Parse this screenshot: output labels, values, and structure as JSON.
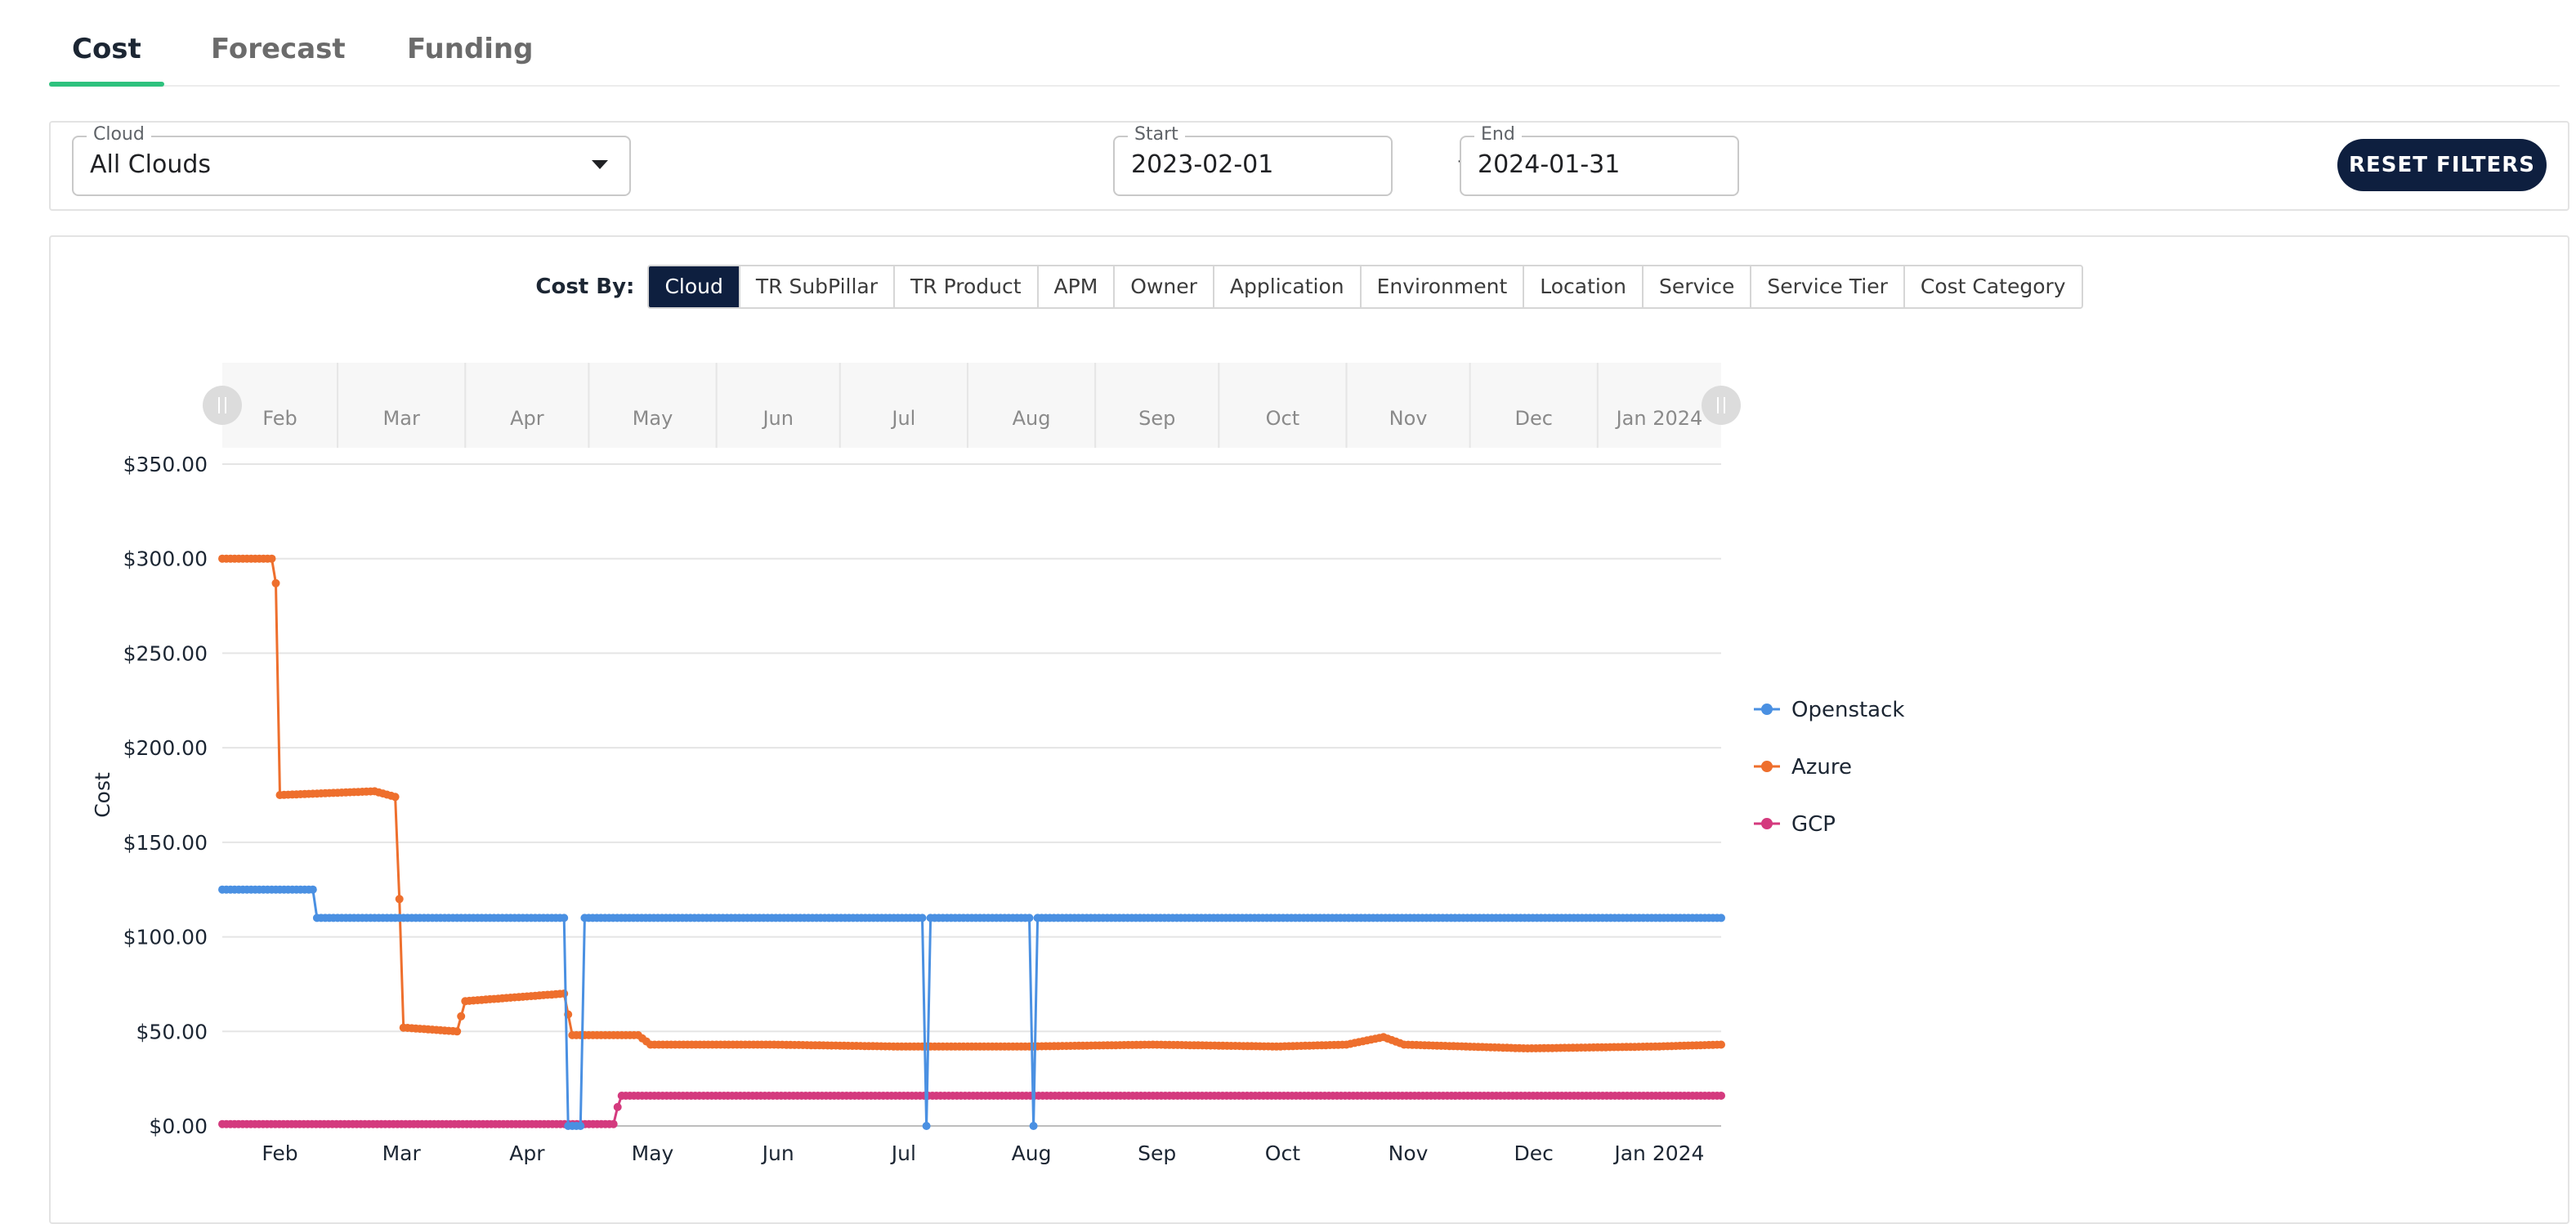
{
  "tabs": [
    {
      "label": "Cost",
      "active": true
    },
    {
      "label": "Forecast",
      "active": false
    },
    {
      "label": "Funding",
      "active": false
    }
  ],
  "filters": {
    "cloud_label": "Cloud",
    "cloud_value": "All Clouds",
    "start_label": "Start",
    "start_value": "2023-02-01",
    "to_label": "to",
    "end_label": "End",
    "end_value": "2024-01-31",
    "reset_label": "RESET FILTERS"
  },
  "cost_by": {
    "label": "Cost By:",
    "options": [
      "Cloud",
      "TR SubPillar",
      "TR Product",
      "APM",
      "Owner",
      "Application",
      "Environment",
      "Location",
      "Service",
      "Service Tier",
      "Cost Category"
    ],
    "selected": "Cloud"
  },
  "colors": {
    "accent": "#2ec27e",
    "button": "#0e1f3f",
    "Openstack": "#4a90e2",
    "Azure": "#ee6f2d",
    "GCP": "#d43a7e"
  },
  "chart_data": {
    "type": "line",
    "ylabel": "Cost",
    "xlabel": "",
    "x_range": [
      "2023-02-01",
      "2024-01-31"
    ],
    "x_ticks": [
      "Feb",
      "Mar",
      "Apr",
      "May",
      "Jun",
      "Jul",
      "Aug",
      "Sep",
      "Oct",
      "Nov",
      "Dec",
      "Jan 2024"
    ],
    "y_ticks": [
      "$0.00",
      "$50.00",
      "$100.00",
      "$150.00",
      "$200.00",
      "$250.00",
      "$300.00",
      "$350.00"
    ],
    "ylim": [
      0,
      350
    ],
    "legend_position": "right",
    "series": [
      {
        "name": "Openstack",
        "points": [
          [
            "2023-02-01",
            125
          ],
          [
            "2023-02-23",
            125
          ],
          [
            "2023-02-24",
            110
          ],
          [
            "2023-04-25",
            110
          ],
          [
            "2023-04-26",
            0
          ],
          [
            "2023-04-29",
            0
          ],
          [
            "2023-04-30",
            110
          ],
          [
            "2023-07-21",
            110
          ],
          [
            "2023-07-22",
            0
          ],
          [
            "2023-07-23",
            110
          ],
          [
            "2023-08-16",
            110
          ],
          [
            "2023-08-17",
            0
          ],
          [
            "2023-08-18",
            110
          ],
          [
            "2024-01-31",
            110
          ]
        ]
      },
      {
        "name": "Azure",
        "points": [
          [
            "2023-02-01",
            300
          ],
          [
            "2023-02-13",
            300
          ],
          [
            "2023-02-14",
            287
          ],
          [
            "2023-02-15",
            175
          ],
          [
            "2023-03-10",
            177
          ],
          [
            "2023-03-15",
            174
          ],
          [
            "2023-03-16",
            120
          ],
          [
            "2023-03-17",
            52
          ],
          [
            "2023-03-30",
            50
          ],
          [
            "2023-04-01",
            66
          ],
          [
            "2023-04-25",
            70
          ],
          [
            "2023-04-26",
            59
          ],
          [
            "2023-04-27",
            48
          ],
          [
            "2023-05-13",
            48
          ],
          [
            "2023-05-16",
            43
          ],
          [
            "2023-06-15",
            43
          ],
          [
            "2023-07-15",
            42
          ],
          [
            "2023-08-15",
            42
          ],
          [
            "2023-09-15",
            43
          ],
          [
            "2023-10-15",
            42
          ],
          [
            "2023-11-01",
            43
          ],
          [
            "2023-11-10",
            47
          ],
          [
            "2023-11-15",
            43
          ],
          [
            "2023-12-15",
            41
          ],
          [
            "2024-01-15",
            42
          ],
          [
            "2024-01-31",
            43
          ]
        ]
      },
      {
        "name": "GCP",
        "points": [
          [
            "2023-02-01",
            1
          ],
          [
            "2023-05-07",
            1
          ],
          [
            "2023-05-08",
            10
          ],
          [
            "2023-05-09",
            16
          ],
          [
            "2024-01-31",
            16
          ]
        ]
      }
    ]
  }
}
